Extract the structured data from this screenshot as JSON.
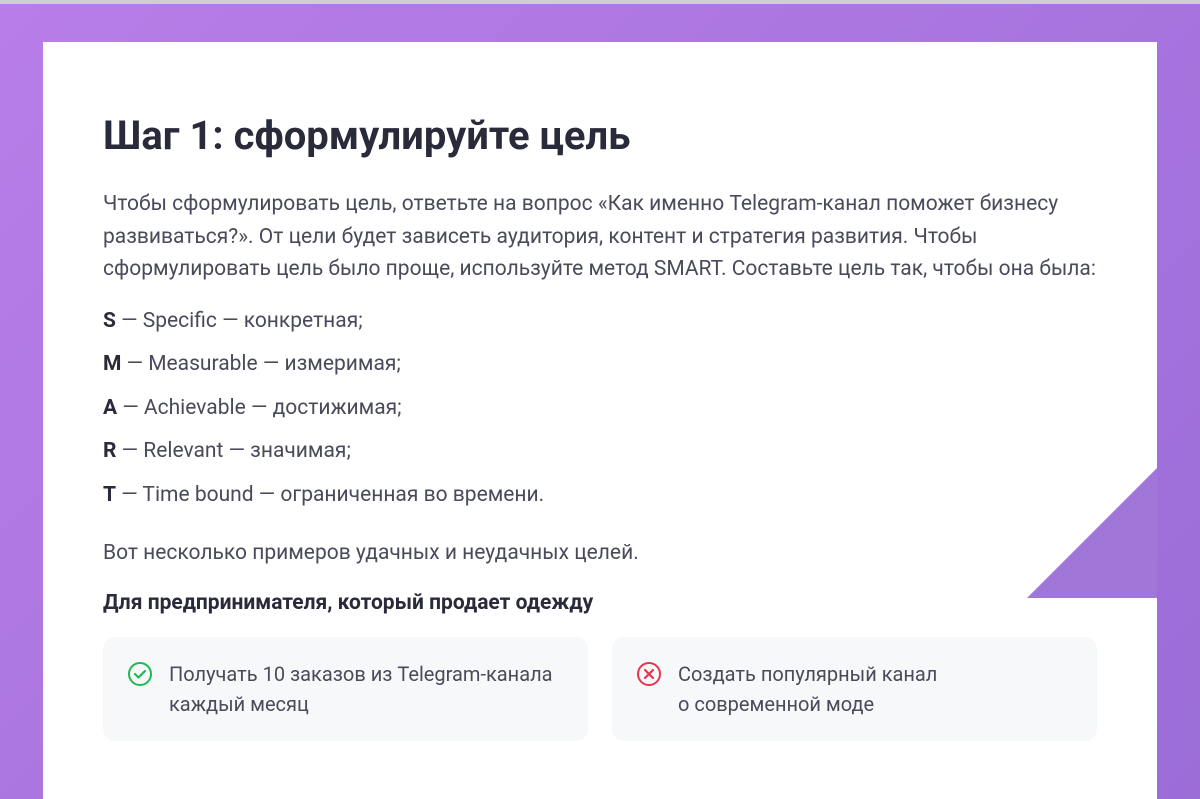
{
  "heading": "Шаг 1: сформулируйте цель",
  "intro": "Чтобы сформулировать цель, ответьте на вопрос «Как именно Telegram-канал поможет бизнесу развиваться?». От цели будет зависеть аудитория, контент и стратегия развития. Чтобы сформулировать цель было проще, используйте метод SMART. Составьте цель так, чтобы она была:",
  "smart": [
    {
      "letter": "S",
      "text": " — Specific — конкретная;"
    },
    {
      "letter": "M",
      "text": " — Measurable — измеримая;"
    },
    {
      "letter": "A",
      "text": " — Achievable — достижимая;"
    },
    {
      "letter": "R",
      "text": " — Relevant — значимая;"
    },
    {
      "letter": "T",
      "text": " — Time bound — ограниченная во времени."
    }
  ],
  "examples_intro": "Вот несколько примеров удачных и неудачных целей.",
  "section_title": "Для предпринимателя, который продает одежду",
  "good_example": "Получать 10 заказов из Telegram-канала каждый месяц",
  "bad_example": "Создать популярный канал о современной моде",
  "colors": {
    "good": "#1db954",
    "bad": "#e8354d"
  }
}
